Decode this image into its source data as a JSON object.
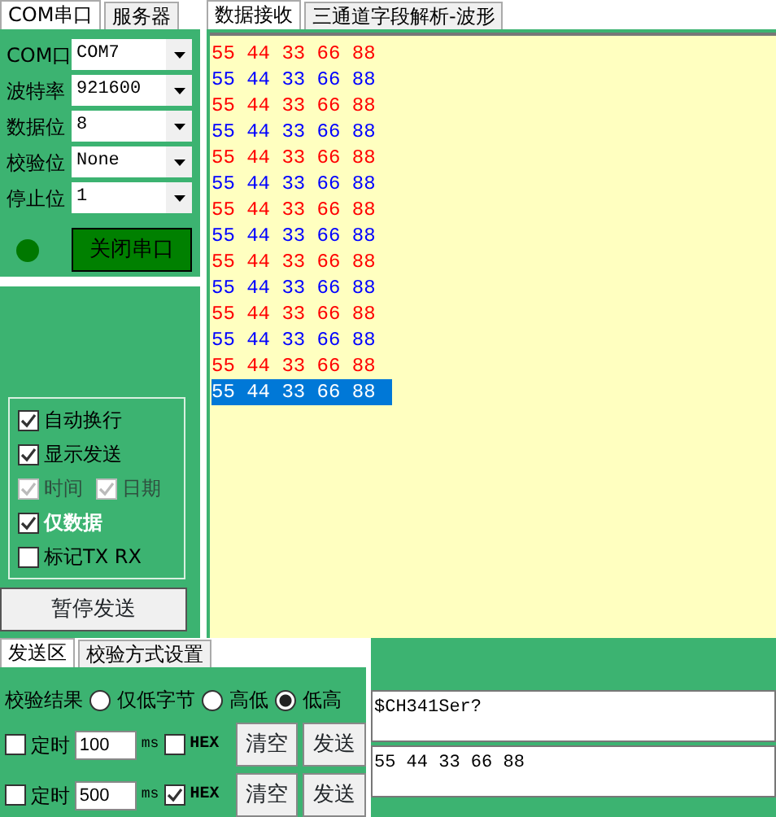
{
  "left_tabs": [
    {
      "label": "COM串口",
      "selected": true
    },
    {
      "label": "服务器",
      "selected": false
    }
  ],
  "settings": [
    {
      "label": "COM口",
      "value": "COM7"
    },
    {
      "label": "波特率",
      "value": "921600"
    },
    {
      "label": "数据位",
      "value": "8"
    },
    {
      "label": "校验位",
      "value": "None"
    },
    {
      "label": "停止位",
      "value": "1"
    }
  ],
  "port_indicator": {
    "on": true
  },
  "close_port_button": "关闭串口",
  "options": [
    {
      "items": [
        {
          "label": "自动换行",
          "checked": true,
          "disabled": false,
          "bold": false
        }
      ]
    },
    {
      "items": [
        {
          "label": "显示发送",
          "checked": true,
          "disabled": false,
          "bold": false
        }
      ]
    },
    {
      "items": [
        {
          "label": "时间",
          "checked": true,
          "disabled": true,
          "bold": false
        },
        {
          "label": "日期",
          "checked": true,
          "disabled": true,
          "bold": false
        }
      ]
    },
    {
      "items": [
        {
          "label": "仅数据",
          "checked": true,
          "disabled": false,
          "bold": true
        }
      ]
    },
    {
      "items": [
        {
          "label": "标记TX RX",
          "checked": false,
          "disabled": false,
          "bold": false
        }
      ]
    }
  ],
  "pause_button": "暂停发送",
  "right_tabs": [
    {
      "label": "数据接收",
      "selected": true
    },
    {
      "label": "三通道字段解析-波形",
      "selected": false
    }
  ],
  "received": [
    {
      "text": "55 44 33 66 88",
      "color": "#ff0000",
      "selected": false
    },
    {
      "text": "55 44 33 66 88",
      "color": "#0000ff",
      "selected": false
    },
    {
      "text": "55 44 33 66 88",
      "color": "#ff0000",
      "selected": false
    },
    {
      "text": "55 44 33 66 88",
      "color": "#0000ff",
      "selected": false
    },
    {
      "text": "55 44 33 66 88",
      "color": "#ff0000",
      "selected": false
    },
    {
      "text": "55 44 33 66 88",
      "color": "#0000ff",
      "selected": false
    },
    {
      "text": "55 44 33 66 88",
      "color": "#ff0000",
      "selected": false
    },
    {
      "text": "55 44 33 66 88",
      "color": "#0000ff",
      "selected": false
    },
    {
      "text": "55 44 33 66 88",
      "color": "#ff0000",
      "selected": false
    },
    {
      "text": "55 44 33 66 88",
      "color": "#0000ff",
      "selected": false
    },
    {
      "text": "55 44 33 66 88",
      "color": "#ff0000",
      "selected": false
    },
    {
      "text": "55 44 33 66 88",
      "color": "#0000ff",
      "selected": false
    },
    {
      "text": "55 44 33 66 88",
      "color": "#ff0000",
      "selected": false
    },
    {
      "text": "55 44 33 66 88",
      "selected": true
    }
  ],
  "send_tabs": [
    {
      "label": "发送区",
      "selected": true
    },
    {
      "label": "校验方式设置",
      "selected": false
    }
  ],
  "checksum": {
    "label": "校验结果",
    "options": [
      {
        "label": "仅低字节",
        "selected": false
      },
      {
        "label": "高低",
        "selected": false
      },
      {
        "label": "低高",
        "selected": true
      }
    ]
  },
  "send_rows": [
    {
      "timer_label": "定时",
      "timer_checked": false,
      "interval": "100",
      "unit": "ms",
      "hex_label": "HEX",
      "hex_checked": false,
      "clear_button": "清空",
      "send_button": "发送",
      "content": "$CH341Ser?"
    },
    {
      "timer_label": "定时",
      "timer_checked": false,
      "interval": "500",
      "unit": "ms",
      "hex_label": "HEX",
      "hex_checked": true,
      "clear_button": "清空",
      "send_button": "发送",
      "content": "55 44 33 66 88"
    }
  ]
}
